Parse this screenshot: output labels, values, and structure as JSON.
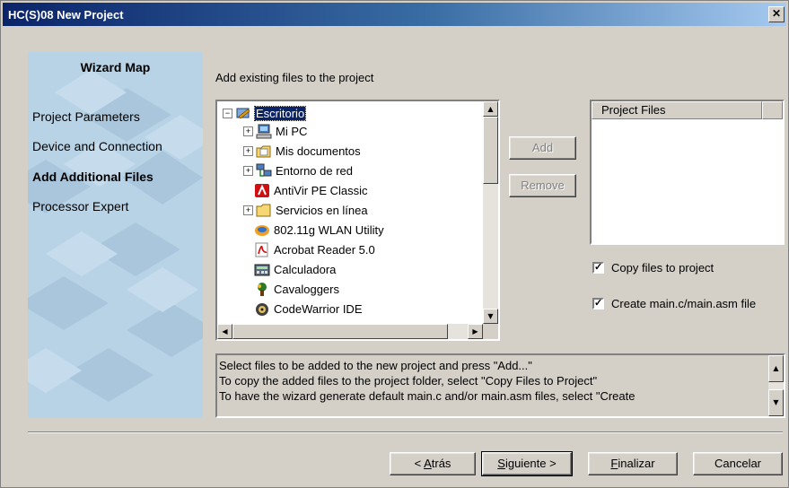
{
  "window": {
    "title": "HC(S)08 New Project",
    "close_glyph": "✕"
  },
  "wizard_map": {
    "title": "Wizard Map",
    "items": [
      {
        "label": "Project Parameters",
        "active": false
      },
      {
        "label": "Device and Connection",
        "active": false
      },
      {
        "label": "Add Additional Files",
        "active": true
      },
      {
        "label": "Processor Expert",
        "active": false
      }
    ]
  },
  "add_files_label": "Add existing files to the project",
  "tree": {
    "items": [
      {
        "label": "Escritorio",
        "icon": "desktop-icon",
        "expander": "−",
        "selected": true
      },
      {
        "label": "Mi PC",
        "icon": "computer-icon",
        "expander": "+"
      },
      {
        "label": "Mis documentos",
        "icon": "documents-folder-icon",
        "expander": "+"
      },
      {
        "label": "Entorno de red",
        "icon": "network-icon",
        "expander": "+"
      },
      {
        "label": "AntiVir PE Classic",
        "icon": "antivir-icon",
        "expander": ""
      },
      {
        "label": "Servicios en línea",
        "icon": "folder-icon",
        "expander": "+"
      },
      {
        "label": "802.11g WLAN Utility",
        "icon": "wlan-icon",
        "expander": ""
      },
      {
        "label": "Acrobat Reader 5.0",
        "icon": "acrobat-icon",
        "expander": ""
      },
      {
        "label": "Calculadora",
        "icon": "calculator-icon",
        "expander": ""
      },
      {
        "label": "Cavaloggers",
        "icon": "cavaloggers-icon",
        "expander": ""
      },
      {
        "label": "CodeWarrior IDE",
        "icon": "codewarrior-icon",
        "expander": ""
      }
    ]
  },
  "buttons": {
    "add": "Add",
    "remove": "Remove"
  },
  "project_files": {
    "header": "Project Files"
  },
  "options": {
    "copy_files": {
      "label": "Copy files to project",
      "checked": true,
      "mark": "✓"
    },
    "create_main": {
      "label": "Create main.c/main.asm file",
      "checked": true,
      "mark": "✓"
    }
  },
  "info_lines": [
    "Select files to be added to the new project and press \"Add...\"",
    "To copy the added files to the project folder, select \"Copy Files to Project\"",
    "To have the wizard generate default main.c and/or main.asm files, select \"Create"
  ],
  "footer": {
    "back": {
      "prefix": "< ",
      "accel": "A",
      "rest": "trás"
    },
    "next": {
      "accel": "S",
      "rest": "iguiente >"
    },
    "finish": {
      "accel": "F",
      "rest": "inalizar"
    },
    "cancel": "Cancelar"
  }
}
